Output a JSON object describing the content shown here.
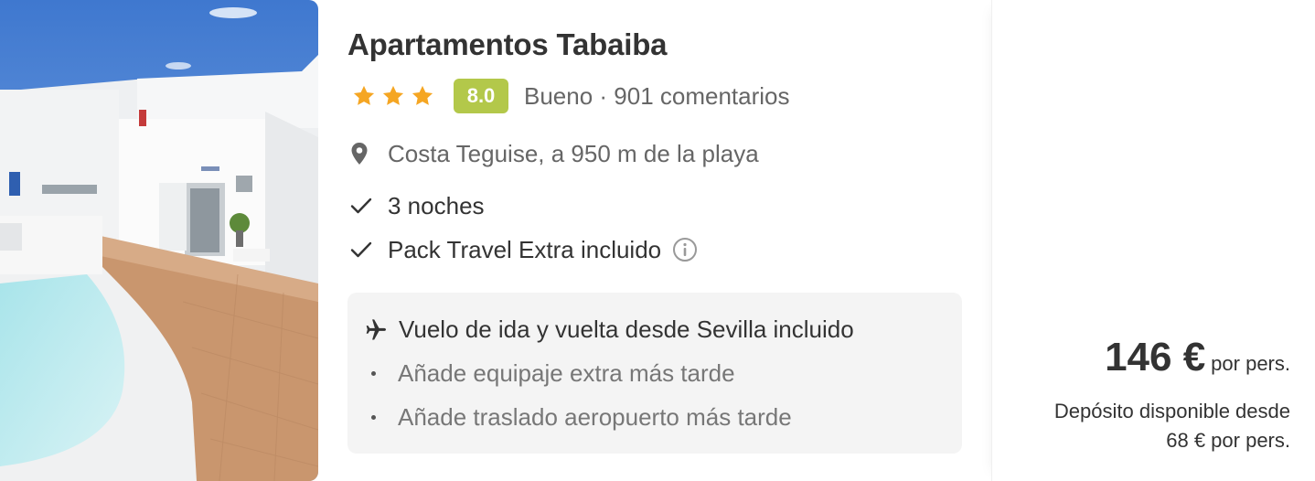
{
  "hotel": {
    "name": "Apartamentos Tabaiba",
    "stars": 3,
    "score": "8.0",
    "score_color": "#b3c84a",
    "star_color": "#f5a623",
    "rating_text": "Bueno · 901 comentarios",
    "location": "Costa Teguise, a 950 m de la playa",
    "location_icon": "map-pin-icon"
  },
  "features": {
    "nights": "3 noches",
    "pack": "Pack Travel Extra incluido",
    "check_icon": "check-icon",
    "info_icon": "info-icon"
  },
  "flight": {
    "icon": "airplane-icon",
    "title": "Vuelo de ida y vuelta desde Sevilla incluido",
    "extras": [
      "Añade equipaje extra más tarde",
      "Añade traslado aeropuerto más tarde"
    ]
  },
  "price": {
    "amount": "146 €",
    "unit": "por pers.",
    "deposit_line1": "Depósito disponible desde",
    "deposit_line2": "68 € por pers."
  }
}
